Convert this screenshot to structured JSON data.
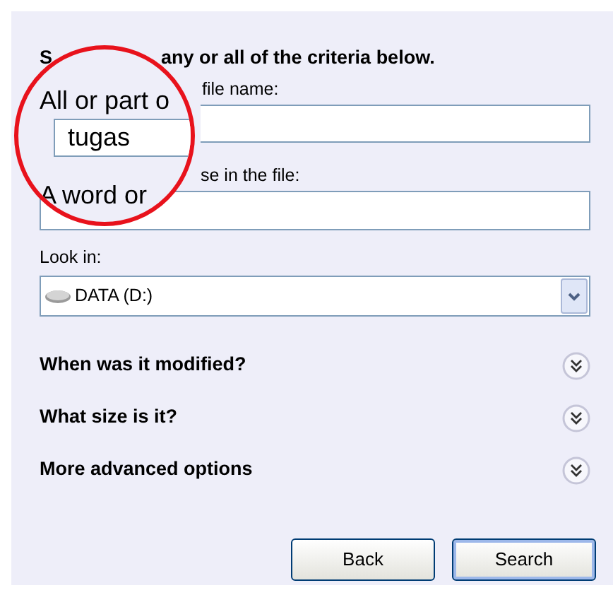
{
  "heading": {
    "start": "S",
    "end": "any or all of the criteria below."
  },
  "file_name": {
    "label_end": "file name:"
  },
  "phrase": {
    "label_end": "se in the file:"
  },
  "look_in": {
    "label": "Look in:",
    "value": "DATA (D:)"
  },
  "sections": [
    {
      "label": "When was it modified?",
      "expanded": false
    },
    {
      "label": "What size is it?",
      "expanded": false
    },
    {
      "label": "More advanced options",
      "expanded": false
    }
  ],
  "buttons": [
    {
      "label": "Back",
      "kind": "back"
    },
    {
      "label": "Search",
      "kind": "search"
    }
  ],
  "magnifier": {
    "file_name_label": "All or part o",
    "file_name_value": "tugas",
    "phrase_label": "A word or"
  }
}
